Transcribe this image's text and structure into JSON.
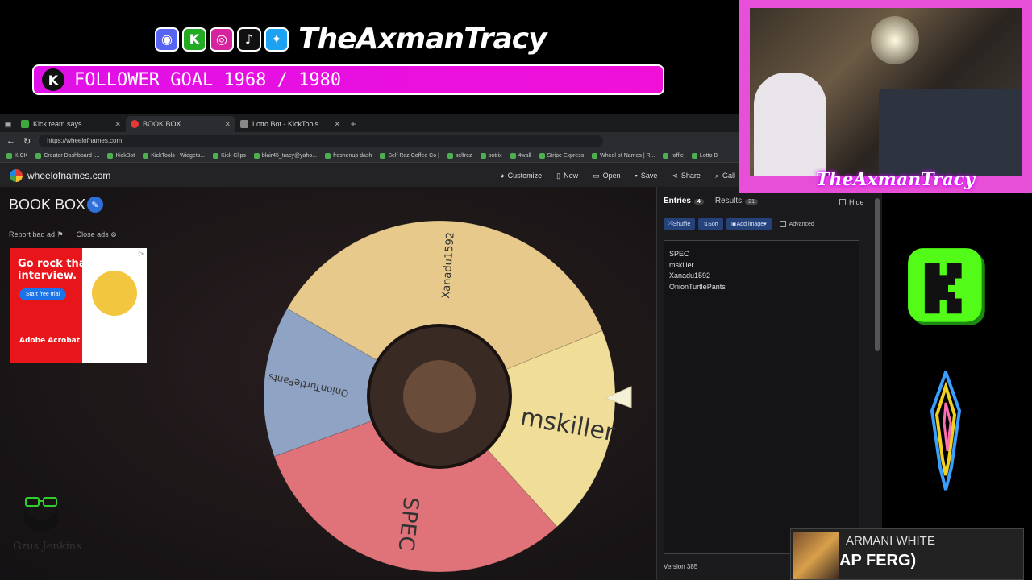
{
  "overlay": {
    "handle": "TheAxmanTracy",
    "social_icons": [
      "discord-icon",
      "kick-icon",
      "instagram-icon",
      "tiktok-icon",
      "twitter-icon"
    ],
    "goal_text": "FOLLOWER GOAL 1968 / 1980",
    "goal_color": "#e010e8",
    "cam_name": "TheAxmanTracy",
    "now_playing_artist": "ARMANI WHITE",
    "now_playing_track": "AP FERG)",
    "watermark_text": "Gzus Jenkins"
  },
  "browser": {
    "tabs": [
      {
        "label": "Kick team says...",
        "active": false
      },
      {
        "label": "BOOK BOX",
        "active": true
      },
      {
        "label": "Lotto Bot - KickTools",
        "active": false
      }
    ],
    "url": "https://wheelofnames.com",
    "bookmarks": [
      "KICK",
      "Creator Dashboard |...",
      "KickBot",
      "KickTools - Widgets...",
      "Kick Clips",
      "blair45_tracy@yaho...",
      "freshenup dash",
      "Self Rez Coffee Co |",
      "selfrez",
      "botrix",
      "4wall",
      "Stripe Express",
      "Wheel of Names | R...",
      "raffle",
      "Lotto B"
    ]
  },
  "app": {
    "site_name": "wheelofnames.com",
    "menu": [
      "Customize",
      "New",
      "Open",
      "Save",
      "Share",
      "Gall"
    ],
    "wheel_title": "BOOK BOX",
    "report_ad": "Report bad ad",
    "close_ads": "Close ads",
    "ad": {
      "headline": "Go rock that interview.",
      "cta": "Start free trial",
      "brand": "Adobe Acrobat Pro"
    },
    "wheel": {
      "segments": [
        {
          "label": "Xanadu1592",
          "color": "#e8c98c"
        },
        {
          "label": "mskiller",
          "color": "#f0dd98"
        },
        {
          "label": "SPEC",
          "color": "#e0737a"
        },
        {
          "label": "OnionTurtlePants",
          "color": "#8fa3c4"
        }
      ]
    },
    "sidebar": {
      "tab_entries": "Entries",
      "entries_count": "4",
      "tab_results": "Results",
      "results_count": "21",
      "hide": "Hide",
      "shuffle": "Shuffle",
      "sort": "Sort",
      "add_image": "Add image",
      "advanced": "Advanced",
      "entries": [
        "SPEC",
        "mskiller",
        "Xanadu1592",
        "OnionTurtlePants"
      ],
      "version": "Version 385"
    }
  }
}
